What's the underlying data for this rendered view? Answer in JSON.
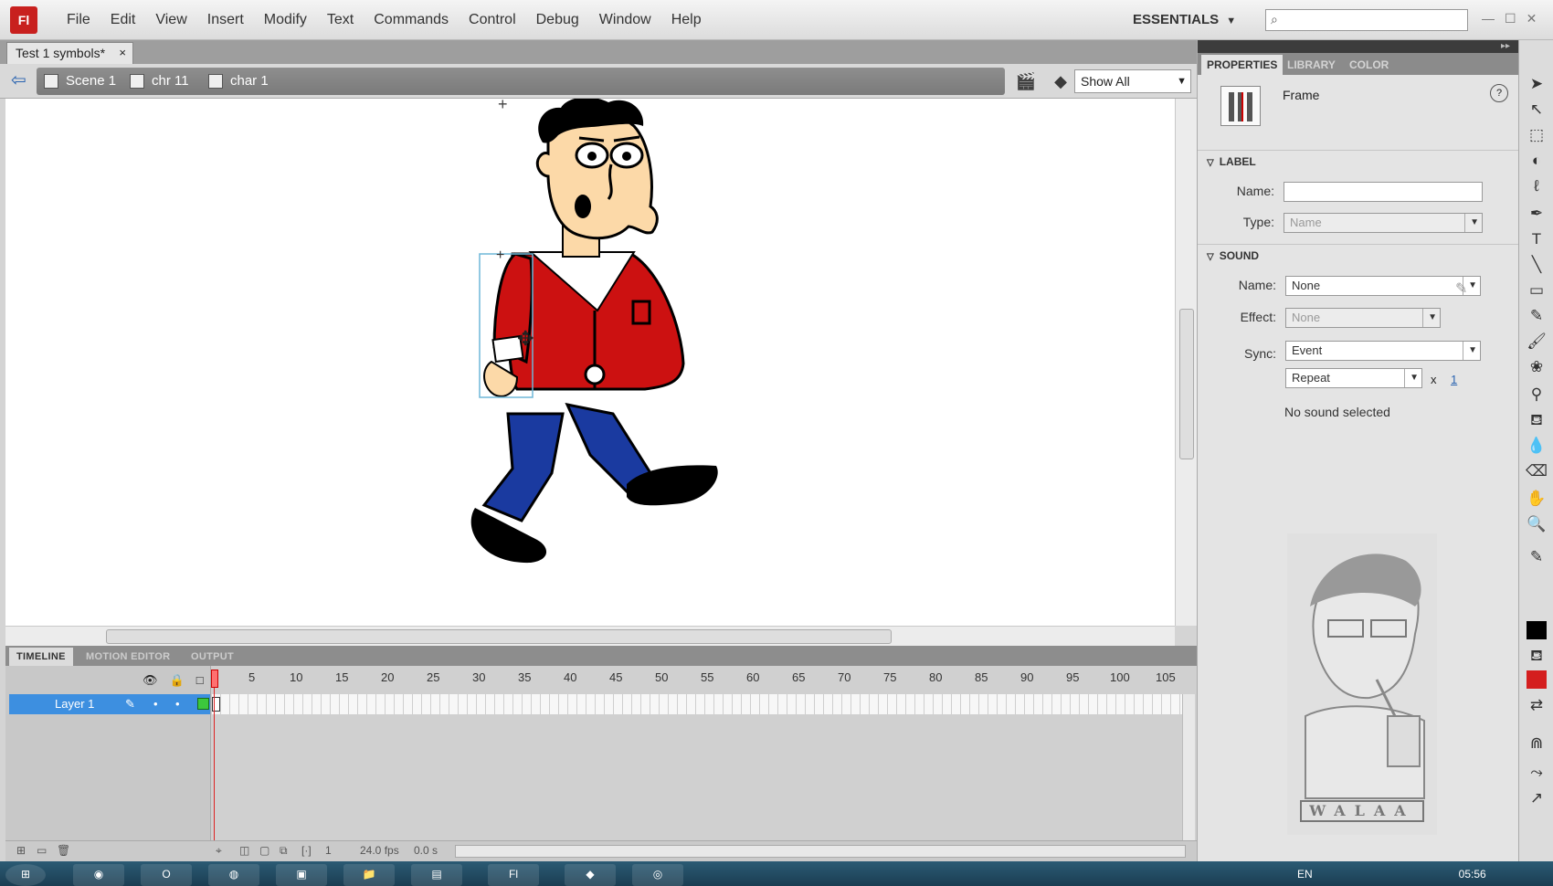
{
  "app": {
    "logo": "Fl"
  },
  "menu": [
    "File",
    "Edit",
    "View",
    "Insert",
    "Modify",
    "Text",
    "Commands",
    "Control",
    "Debug",
    "Window",
    "Help"
  ],
  "workspace": {
    "label": "ESSENTIALS"
  },
  "document": {
    "tab_label": "Test 1 symbols*",
    "close": "×"
  },
  "breadcrumb": {
    "items": [
      "Scene 1",
      "chr 11",
      "char 1"
    ]
  },
  "zoom": {
    "value": "Show All"
  },
  "timeline": {
    "tabs": [
      "TIMELINE",
      "MOTION EDITOR",
      "OUTPUT"
    ],
    "layer_name": "Layer 1",
    "ruler": [
      "1",
      "5",
      "10",
      "15",
      "20",
      "25",
      "30",
      "35",
      "40",
      "45",
      "50",
      "55",
      "60",
      "65",
      "70",
      "75",
      "80",
      "85",
      "90",
      "95",
      "100",
      "105"
    ],
    "current_frame": "1",
    "fps": "24.0 fps",
    "elapsed": "0.0 s"
  },
  "properties": {
    "tabs": [
      "PROPERTIES",
      "LIBRARY",
      "COLOR"
    ],
    "title": "Frame",
    "label_section": "LABEL",
    "name_label": "Name:",
    "type_label": "Type:",
    "type_value": "Name",
    "sound_section": "SOUND",
    "sound_name_label": "Name:",
    "sound_name_value": "None",
    "effect_label": "Effect:",
    "effect_value": "None",
    "sync_label": "Sync:",
    "sync_value": "Event",
    "repeat_value": "Repeat",
    "repeat_x": "x",
    "repeat_count": "1",
    "status": "No sound selected"
  },
  "watermark": {
    "text": "WALAA"
  },
  "taskbar": {
    "lang": "EN",
    "time": "05:56"
  },
  "colors": {
    "stroke": "#000000",
    "fill": "#d41e1e",
    "layer_highlight": "#3d8fe0",
    "jacket": "#cc1111",
    "pants": "#1a3aa0",
    "skin": "#fcd9a8"
  }
}
